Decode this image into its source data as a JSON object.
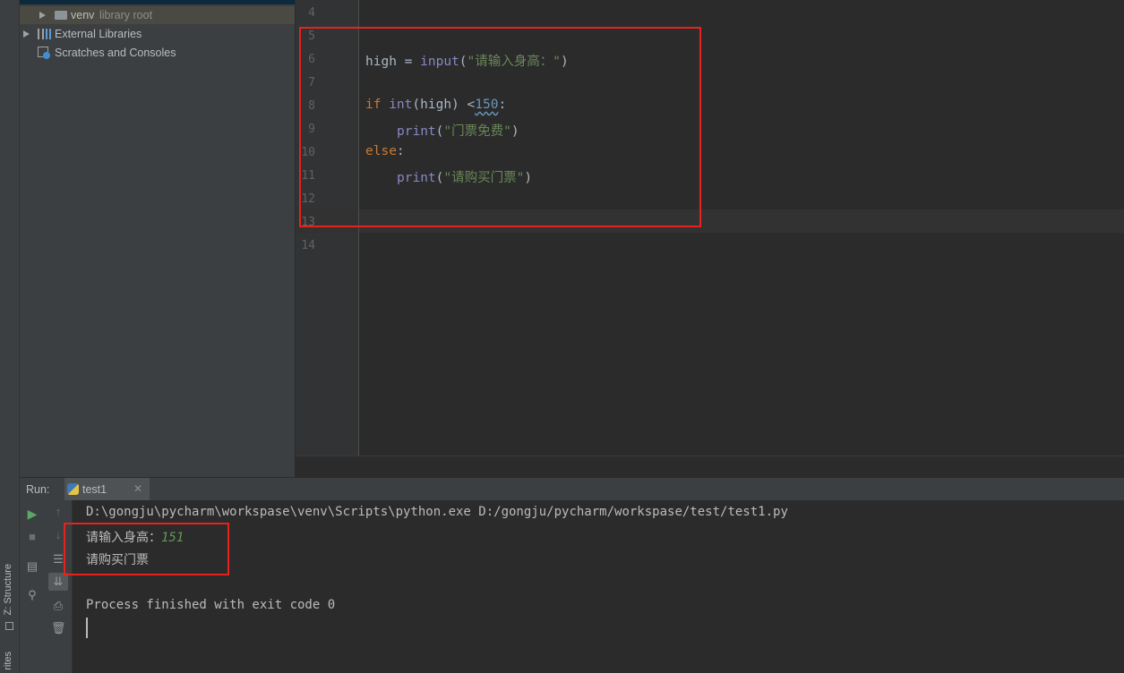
{
  "sidebar": {
    "structure_label": "Z: Structure",
    "favorites_label": "rites"
  },
  "project_tree": {
    "items": [
      {
        "name": "venv",
        "suffix": "library root"
      },
      {
        "name": "External Libraries"
      },
      {
        "name": "Scratches and Consoles"
      }
    ]
  },
  "editor": {
    "line_numbers": [
      "4",
      "5",
      "6",
      "7",
      "8",
      "9",
      "10",
      "11",
      "12",
      "13",
      "14"
    ],
    "code": {
      "l6": {
        "var": "high",
        "op": " = ",
        "fn": "input",
        "open": "(",
        "str": "\"请输入身高：\"",
        "close": ")"
      },
      "l8": {
        "kw": "if",
        "fn": "int",
        "args": "(high) <",
        "num": "150",
        "colon": ":"
      },
      "l9": {
        "fn": "print",
        "open": "(",
        "str": "\"门票免费\"",
        "close": ")"
      },
      "l10": {
        "kw": "else",
        "colon": ":"
      },
      "l11": {
        "fn": "print",
        "open": "(",
        "str": "\"请购买门票\"",
        "close": ")"
      }
    }
  },
  "run": {
    "title": "Run:",
    "tab_label": "test1",
    "command": "D:\\gongju\\pycharm\\workspase\\venv\\Scripts\\python.exe D:/gongju/pycharm/workspase/test/test1.py",
    "prompt": "请输入身高：",
    "user_input": "151",
    "output": "请购买门票",
    "exit_message": "Process finished with exit code 0"
  },
  "colors": {
    "highlight_box": "#e8211d",
    "keyword": "#cc7832",
    "builtin": "#8888c6",
    "string": "#6a8759",
    "number": "#6897bb"
  }
}
